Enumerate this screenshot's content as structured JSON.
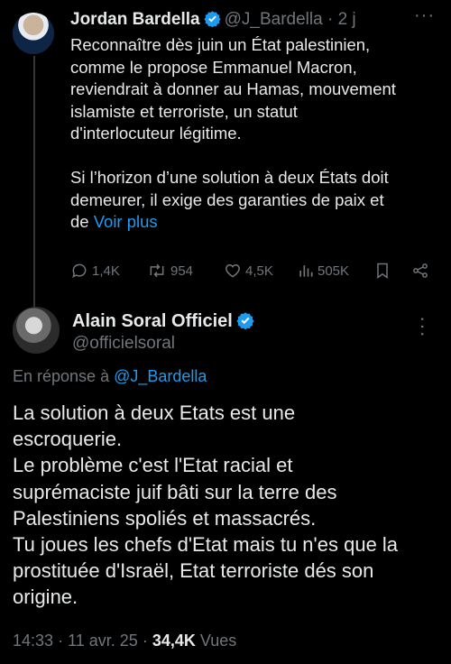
{
  "tweet1": {
    "author_name": "Jordan Bardella",
    "handle": "@J_Bardella",
    "separator": "·",
    "time": "2 j",
    "paragraph1_lines": [
      "Reconnaître dès juin un État palestinien,",
      "comme le propose Emmanuel Macron,",
      "reviendrait à donner au Hamas, mouvement",
      "islamiste et terroriste, un statut",
      "d'interlocuteur légitime."
    ],
    "paragraph2_lines": [
      "Si l’horizon d’une solution à deux États doit",
      "demeurer, il exige des garanties de paix et"
    ],
    "paragraph2_last_prefix": "de ",
    "see_more": "Voir plus",
    "stats": {
      "replies": "1,4K",
      "reposts": "954",
      "likes": "4,5K",
      "views": "505K"
    }
  },
  "tweet2": {
    "author_name": "Alain Soral Officiel",
    "handle": "@officielsoral",
    "reply_prefix": "En réponse à",
    "reply_handle": "@J_Bardella",
    "body_lines": [
      "La solution à deux Etats est une",
      "escroquerie.",
      "Le problème c'est l'Etat racial et",
      "suprémaciste juif bâti sur la terre des",
      "Palestiniens spoliés et massacrés.",
      "Tu joues les chefs d'Etat mais tu n'es que la",
      "prostituée d'Israël, Etat terroriste dés son",
      "origine."
    ],
    "time": "14:33",
    "date": "11 avr. 25",
    "separator": "·",
    "views_count": "34,4K",
    "views_label": "Vues"
  },
  "more_glyph": "···",
  "colors": {
    "background": "#000000",
    "text": "#e7e9ea",
    "secondary": "#71767b",
    "link": "#1d9bf0",
    "verified": "#1d9bf0"
  },
  "icons": [
    "verified-badge-icon",
    "more-options-icon",
    "reply-icon",
    "repost-icon",
    "like-icon",
    "views-icon",
    "bookmark-icon",
    "share-icon"
  ]
}
